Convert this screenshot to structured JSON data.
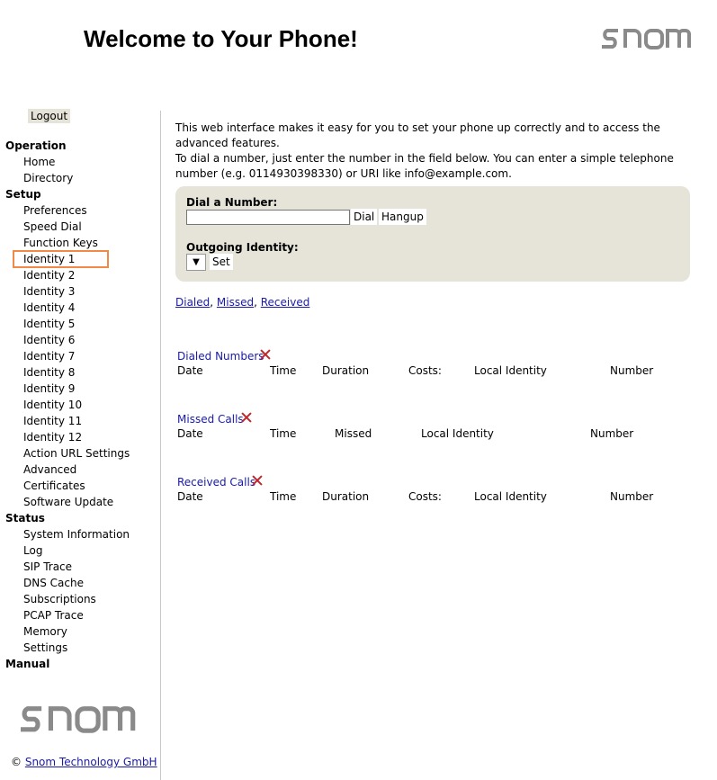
{
  "header": {
    "title": "Welcome to Your Phone!",
    "logo": "snom"
  },
  "sidebar": {
    "logout_label": "Logout",
    "sections": {
      "operation": {
        "title": "Operation",
        "items": [
          "Home",
          "Directory"
        ]
      },
      "setup": {
        "title": "Setup",
        "items": [
          "Preferences",
          "Speed Dial",
          "Function Keys",
          "Identity 1",
          "Identity 2",
          "Identity 3",
          "Identity 4",
          "Identity 5",
          "Identity 6",
          "Identity 7",
          "Identity 8",
          "Identity 9",
          "Identity 10",
          "Identity 11",
          "Identity 12",
          "Action URL Settings",
          "Advanced",
          "Certificates",
          "Software Update"
        ]
      },
      "status": {
        "title": "Status",
        "items": [
          "System Information",
          "Log",
          "SIP Trace",
          "DNS Cache",
          "Subscriptions",
          "PCAP Trace",
          "Memory",
          "Settings"
        ]
      },
      "manual": {
        "title": "Manual",
        "items": []
      }
    },
    "active_item": "Identity 1",
    "highlight_color": "#f08a48"
  },
  "footer": {
    "copyright_symbol": "©",
    "company_link": "Snom Technology GmbH"
  },
  "main": {
    "intro_line1": "This web interface makes it easy for you to set your phone up correctly and to access the advanced features.",
    "intro_line2": "To dial a number, just enter the number in the field below. You can enter a simple telephone number (e.g. 0114930398330) or URI like info@example.com.",
    "dial": {
      "label": "Dial a Number:",
      "input_value": "",
      "dial_button": "Dial",
      "hangup_button": "Hangup",
      "identity_label": "Outgoing Identity:",
      "identity_arrow": "▼",
      "set_button": "Set"
    },
    "links": {
      "dialed": "Dialed",
      "missed": "Missed",
      "received": "Received",
      "separator": ", "
    },
    "dialed_numbers": {
      "title": "Dialed Numbers",
      "columns": [
        "Date",
        "Time",
        "Duration",
        "Costs:",
        "Local Identity",
        "Number"
      ]
    },
    "missed_calls": {
      "title": "Missed Calls",
      "columns": [
        "Date",
        "Time",
        "Missed",
        "Local Identity",
        "Number"
      ]
    },
    "received_calls": {
      "title": "Received Calls",
      "columns": [
        "Date",
        "Time",
        "Duration",
        "Costs:",
        "Local Identity",
        "Number"
      ]
    }
  },
  "colors": {
    "accent_link": "#1a1aa8",
    "delete_icon": "#c0272d",
    "panel_bg": "#e6e4d9"
  }
}
